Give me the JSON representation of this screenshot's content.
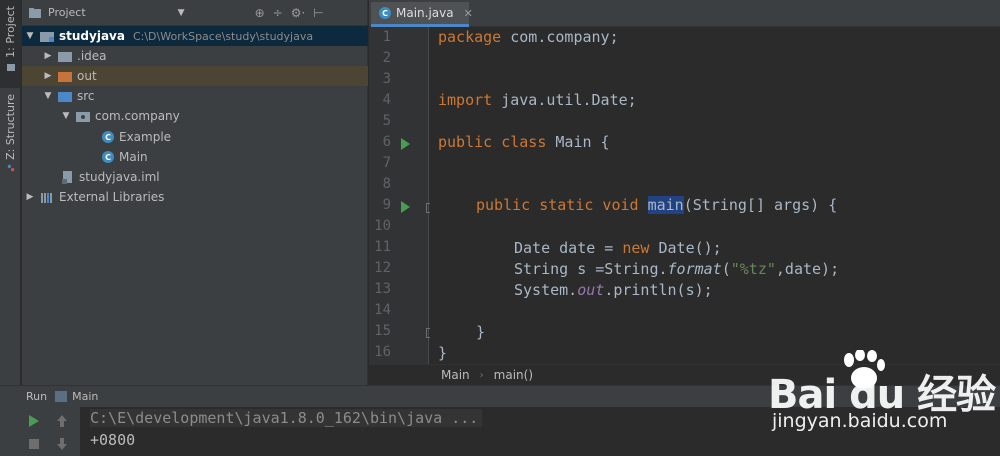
{
  "side_strip": {
    "project_label": "1: Project",
    "structure_label": "Z: Structure"
  },
  "project_panel": {
    "title": "Project",
    "dropdown": "▼",
    "tool_icons": [
      "⊕",
      "÷",
      "⚙·",
      "⊢"
    ],
    "tree": [
      {
        "name": "studyjava",
        "path": "C:\\D\\WorkSpace\\study\\studyjava",
        "expanded": true
      },
      {
        "name": ".idea"
      },
      {
        "name": "out"
      },
      {
        "name": "src"
      },
      {
        "name": "com.company"
      },
      {
        "name": "Example"
      },
      {
        "name": "Main"
      },
      {
        "name": "studyjava.iml"
      },
      {
        "name": "External Libraries"
      }
    ]
  },
  "editor": {
    "tab_label": "Main.java",
    "tab_close": "✕",
    "line_numbers": [
      "1",
      "2",
      "3",
      "4",
      "5",
      "6",
      "7",
      "8",
      "9",
      "10",
      "11",
      "12",
      "13",
      "14",
      "15",
      "16"
    ],
    "breadcrumbs": [
      "Main",
      "main()"
    ],
    "breadcrumb_sep": "›"
  },
  "code": {
    "l1_kw": "package",
    "l1_rest": " com.company;",
    "l4_kw": "import",
    "l4_rest": " java.util.Date;",
    "l6_kw": "public class",
    "l6_rest": " Main {",
    "l9_kw": "public static void",
    "l9_method": "main",
    "l9_rest": "(String[] args) {",
    "l11_a": "Date date = ",
    "l11_kw": "new",
    "l11_b": " Date();",
    "l12_a": "String s =String.",
    "l12_it": "format",
    "l12_b": "(",
    "l12_str": "\"%tz\"",
    "l12_c": ",date);",
    "l13_a": "System.",
    "l13_field": "out",
    "l13_b": ".println(s);",
    "l15": "}",
    "l16": "}"
  },
  "run_panel": {
    "run_label": "Run",
    "config_name": "Main",
    "console": [
      "C:\\E\\development\\java1.8.0_162\\bin\\java ...",
      "+0800"
    ]
  },
  "watermark": {
    "brand": "Bai du 经验",
    "url": "jingyan.baidu.com"
  },
  "colors": {
    "keyword": "#cc7832",
    "string": "#6a8759",
    "field": "#9876aa",
    "run_green": "#499c54",
    "selection": "#0d293e"
  }
}
